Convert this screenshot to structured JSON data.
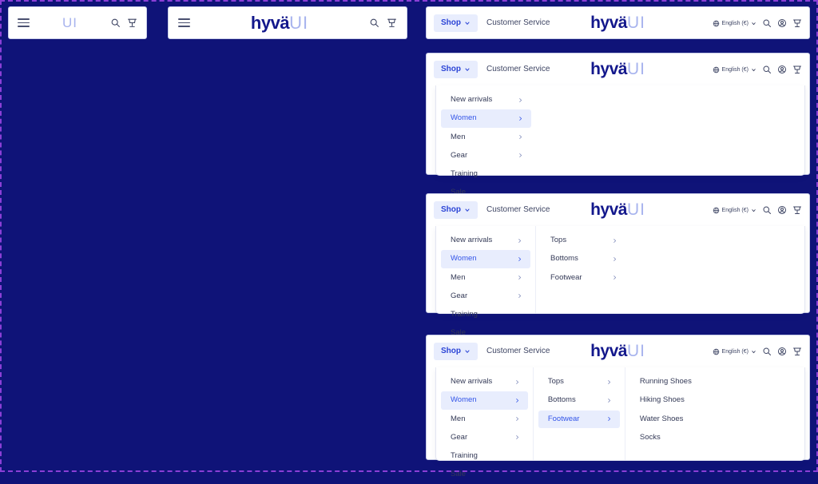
{
  "page": {
    "background_color": "#0f1378",
    "frame_border_color": "#8b3fd6"
  },
  "brand": {
    "name_primary": "hyvä",
    "name_secondary": "UI",
    "primary_color": "#13188c",
    "secondary_color": "#a8b4ee"
  },
  "mobile_headers": [
    {
      "menu_icon": "hamburger-icon",
      "logo_primary": "",
      "logo_secondary": "UI",
      "icons": [
        "search-icon",
        "cart-icon"
      ]
    },
    {
      "menu_icon": "hamburger-icon",
      "logo_primary": "hyvä",
      "logo_secondary": "UI",
      "icons": [
        "search-icon",
        "cart-icon"
      ]
    }
  ],
  "desktop_header": {
    "shop_label": "Shop",
    "shop_chevron": "chevron-down-icon",
    "customer_service_label": "Customer Service",
    "logo_primary": "hyvä",
    "logo_secondary": "UI",
    "language_label": "English (€)",
    "language_globe_icon": "globe-icon",
    "language_chevron": "chevron-down-icon",
    "icons": [
      "search-icon",
      "account-icon",
      "cart-icon"
    ]
  },
  "menus": {
    "level1": [
      {
        "label": "New arrivals",
        "has_children": true,
        "active": false
      },
      {
        "label": "Women",
        "has_children": true,
        "active": true
      },
      {
        "label": "Men",
        "has_children": true,
        "active": false
      },
      {
        "label": "Gear",
        "has_children": true,
        "active": false
      },
      {
        "label": "Training",
        "has_children": false,
        "active": false
      },
      {
        "label": "Sale",
        "has_children": false,
        "active": false
      }
    ],
    "level2": [
      {
        "label": "Tops",
        "has_children": true,
        "active": false
      },
      {
        "label": "Bottoms",
        "has_children": true,
        "active": false
      },
      {
        "label": "Footwear",
        "has_children": true,
        "active": false
      }
    ],
    "level2_with_footwear_active": [
      {
        "label": "Tops",
        "has_children": true,
        "active": false
      },
      {
        "label": "Bottoms",
        "has_children": true,
        "active": false
      },
      {
        "label": "Footwear",
        "has_children": true,
        "active": true
      }
    ],
    "level3": [
      {
        "label": "Running Shoes",
        "has_children": false,
        "active": false
      },
      {
        "label": "Hiking Shoes",
        "has_children": false,
        "active": false
      },
      {
        "label": "Water Shoes",
        "has_children": false,
        "active": false
      },
      {
        "label": "Socks",
        "has_children": false,
        "active": false
      }
    ]
  },
  "variants": [
    {
      "id": "header-collapsed",
      "columns": 0
    },
    {
      "id": "menu-level-1-open",
      "columns": 1
    },
    {
      "id": "menu-level-2-open",
      "columns": 2
    },
    {
      "id": "menu-level-3-open",
      "columns": 3
    }
  ]
}
